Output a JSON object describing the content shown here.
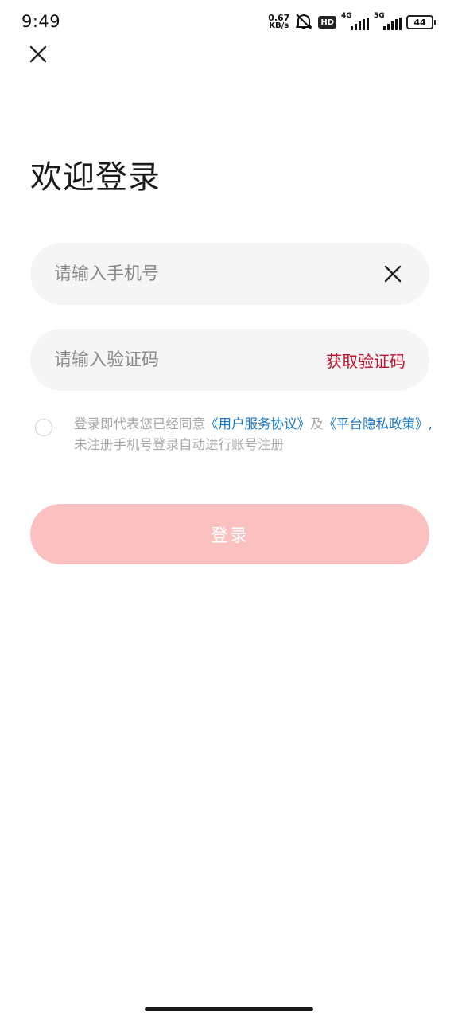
{
  "status_bar": {
    "time": "9:49",
    "net_speed_value": "0.67",
    "net_speed_unit": "KB/s",
    "hd_label": "HD",
    "signal1_label": "4G",
    "signal2_label": "5G",
    "battery": "44",
    "icons": [
      "mute-icon",
      "hd-icon",
      "signal-4g-icon",
      "signal-5g-icon",
      "battery-icon"
    ]
  },
  "page": {
    "title": "欢迎登录"
  },
  "phone_field": {
    "placeholder": "请输入手机号"
  },
  "code_field": {
    "placeholder": "请输入验证码",
    "get_code_label": "获取验证码"
  },
  "agreement": {
    "prefix": "登录即代表您已经同意",
    "user_agreement": "《用户服务协议》",
    "and": "及",
    "privacy_policy": "《平台隐私政策》,",
    "suffix": "未注册手机号登录自动进行账号注册"
  },
  "login_button": {
    "label": "登录"
  },
  "colors": {
    "accent": "#c8102e",
    "link": "#1777c9",
    "login_disabled": "#fbc0c0",
    "field_bg": "#f5f5f5"
  }
}
